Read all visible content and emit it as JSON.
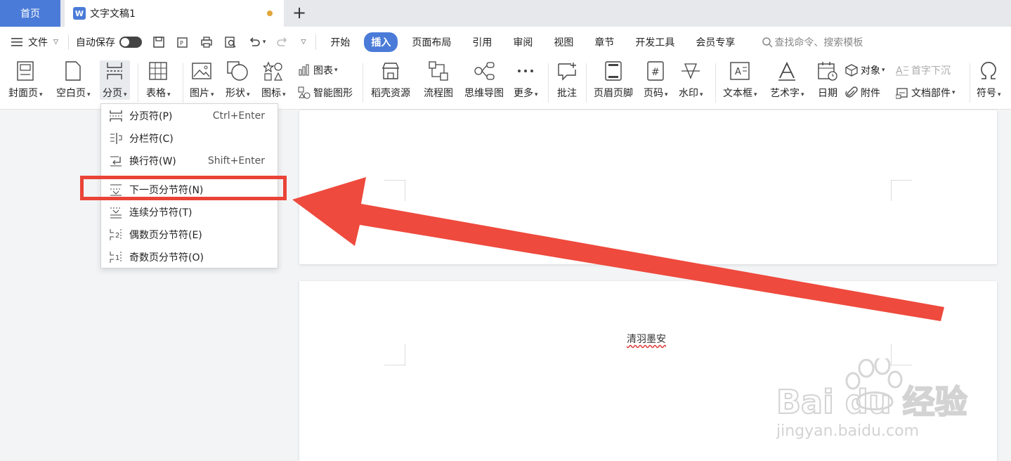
{
  "tabs": {
    "home": "首页",
    "doc_title": "文字文稿1"
  },
  "menubar": {
    "file": "文件",
    "autosave": "自动保存",
    "tabs": [
      "开始",
      "插入",
      "页面布局",
      "引用",
      "审阅",
      "视图",
      "章节",
      "开发工具",
      "会员专享"
    ],
    "active_tab": "插入",
    "search_placeholder": "查找命令、搜索模板"
  },
  "ribbon": {
    "cover_page": "封面页",
    "blank_page": "空白页",
    "page_break": "分页",
    "table": "表格",
    "picture": "图片",
    "shape": "形状",
    "icon": "图标",
    "chart": "图表",
    "smart_art": "智能图形",
    "docer_resources": "稻壳资源",
    "flowchart": "流程图",
    "mindmap": "思维导图",
    "more": "更多",
    "comment": "批注",
    "header_footer": "页眉页脚",
    "page_number": "页码",
    "watermark": "水印",
    "textbox": "文本框",
    "wordart": "艺术字",
    "date": "日期",
    "object": "对象",
    "attachment": "附件",
    "drop_cap": "首字下沉",
    "doc_parts": "文档部件",
    "symbol": "符号"
  },
  "dropdown": {
    "items": [
      {
        "label": "分页符(P)",
        "shortcut": "Ctrl+Enter"
      },
      {
        "label": "分栏符(C)",
        "shortcut": ""
      },
      {
        "label": "换行符(W)",
        "shortcut": "Shift+Enter"
      },
      {
        "label": "下一页分节符(N)",
        "shortcut": ""
      },
      {
        "label": "连续分节符(T)",
        "shortcut": ""
      },
      {
        "label": "偶数页分节符(E)",
        "shortcut": ""
      },
      {
        "label": "奇数页分节符(O)",
        "shortcut": ""
      }
    ]
  },
  "document": {
    "page2_text": "清羽墨安"
  },
  "watermark": {
    "brand": "Bai du 经验",
    "url": "jingyan.baidu.com"
  },
  "colors": {
    "accent": "#4a7bd8",
    "annotation": "#e94437",
    "unsaved": "#e0a63a"
  }
}
